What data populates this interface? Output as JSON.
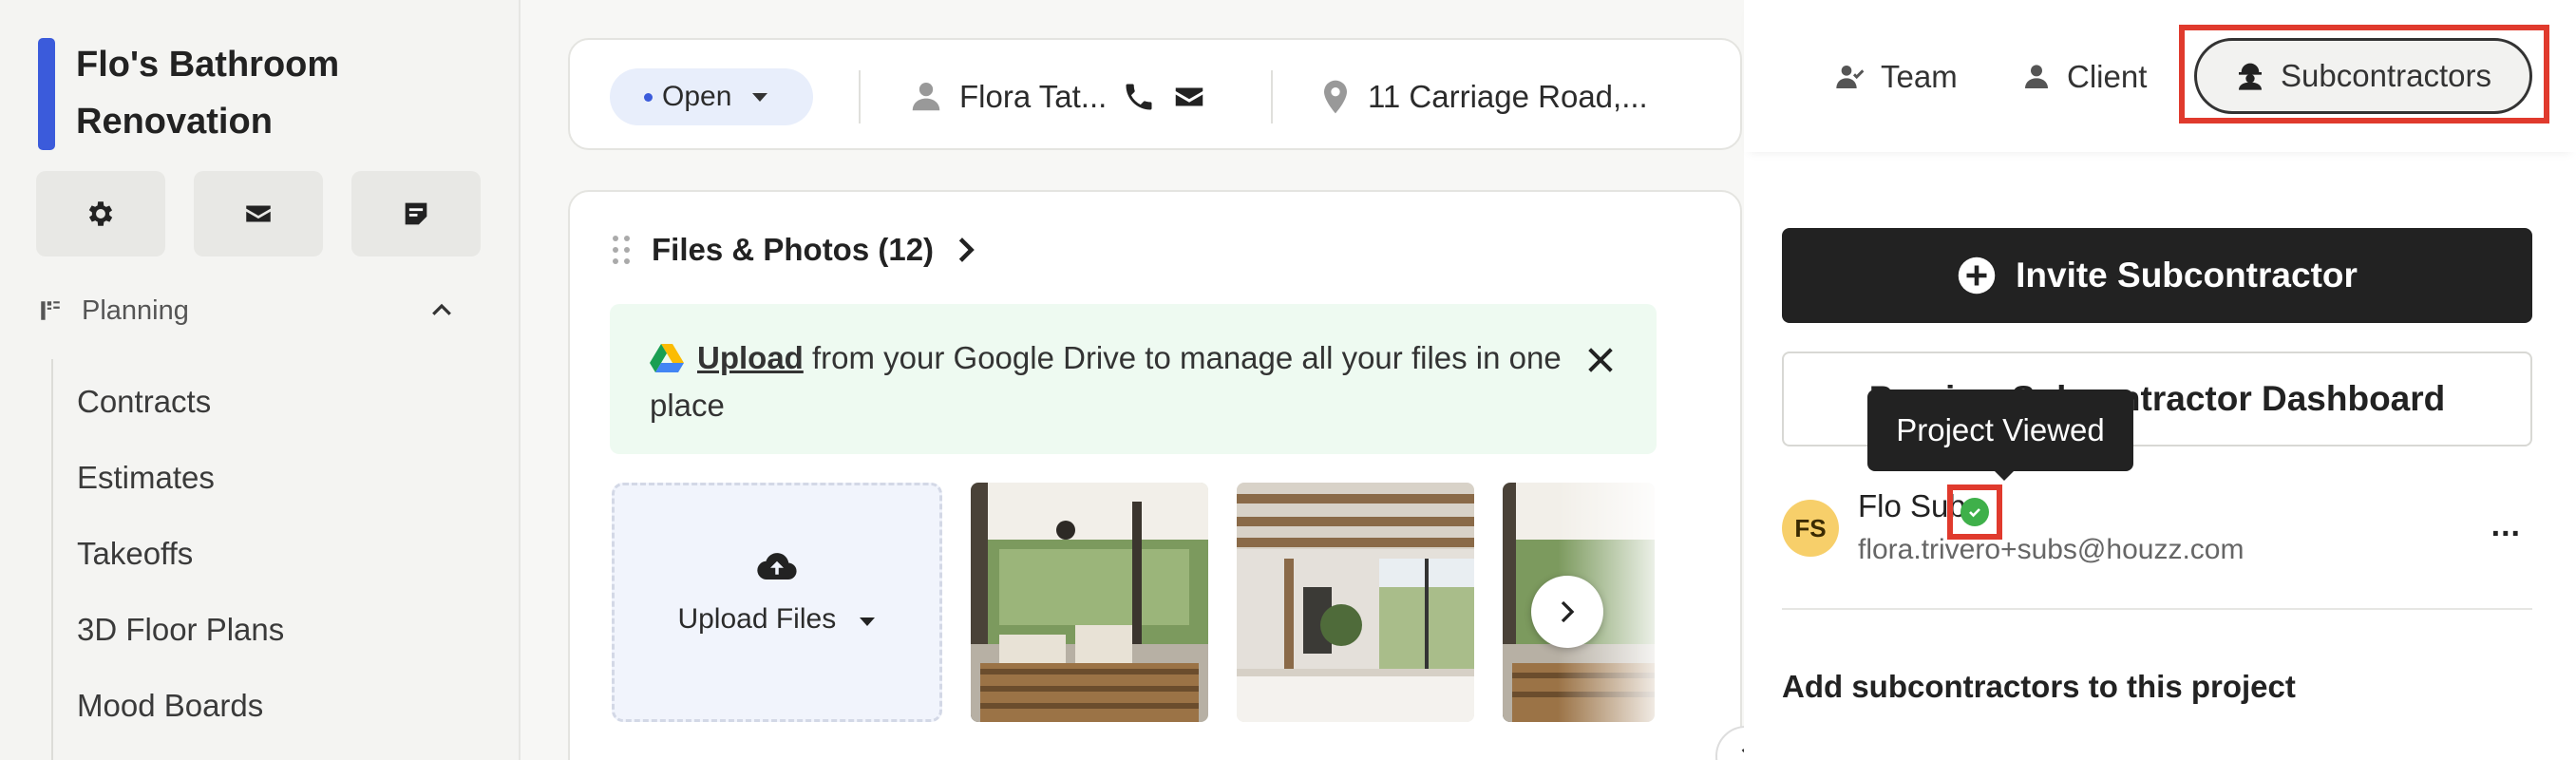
{
  "project": {
    "title": "Flo's Bathroom Renovation"
  },
  "sidebar": {
    "quick_actions": [
      {
        "icon": "gear-icon"
      },
      {
        "icon": "mail-icon"
      },
      {
        "icon": "notes-icon"
      }
    ],
    "section": {
      "label": "Planning",
      "expanded": true
    },
    "items": [
      {
        "label": "Contracts"
      },
      {
        "label": "Estimates"
      },
      {
        "label": "Takeoffs"
      },
      {
        "label": "3D Floor Plans"
      },
      {
        "label": "Mood Boards"
      }
    ]
  },
  "topbar": {
    "status": "Open",
    "client_name": "Flora Tat...",
    "address": "11 Carriage Road,..."
  },
  "files": {
    "title": "Files & Photos (12)",
    "gdrive_link": "Upload",
    "gdrive_text": " from your Google Drive to manage all your files in one place",
    "upload_label": "Upload Files"
  },
  "panel": {
    "tabs": [
      {
        "label": "Team",
        "icon": "team-icon"
      },
      {
        "label": "Client",
        "icon": "user-icon"
      },
      {
        "label": "Subcontractors",
        "icon": "subcontractor-icon",
        "active": true
      }
    ],
    "invite_label": "Invite Subcontractor",
    "preview_label": "Preview Subcontractor Dashboard",
    "tooltip": "Project Viewed",
    "subcontractor": {
      "initials": "FS",
      "name": "Flo Sub",
      "email": "flora.trivero+subs@houzz.com",
      "more": "..."
    },
    "add_label": "Add subcontractors to this project"
  },
  "colors": {
    "accent": "#3b5bdb",
    "highlight": "#e03a2d",
    "primary_button": "#222222",
    "success": "#3fb04a",
    "avatar": "#f7cf6a"
  }
}
